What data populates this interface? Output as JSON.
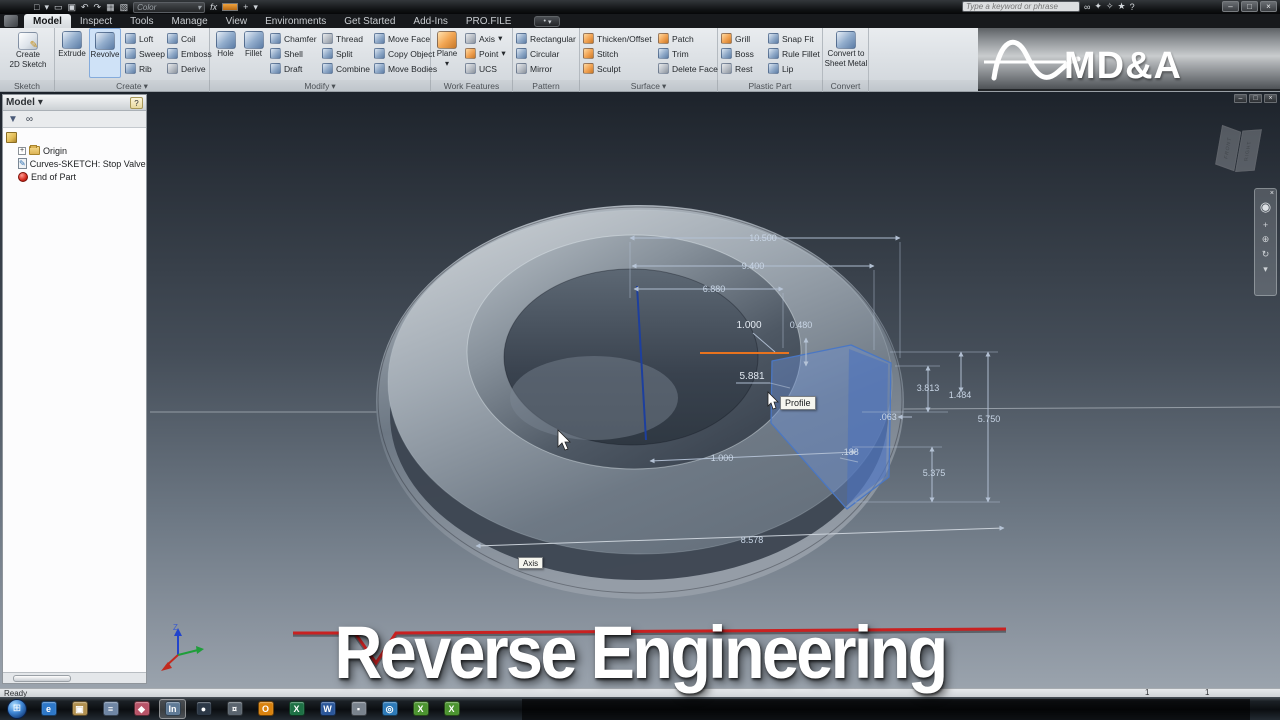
{
  "icons": {
    "caret": "▾",
    "plus": "+",
    "expander": "+",
    "dot": "•"
  },
  "app": {
    "search_placeholder": "Type a keyword or phrase",
    "tabs": [
      "Model",
      "Inspect",
      "Tools",
      "Manage",
      "View",
      "Environments",
      "Get Started",
      "Add-Ins",
      "PRO.FILE"
    ],
    "window": {
      "minimize": "–",
      "restore": "□",
      "close": "×"
    },
    "qat": {
      "color_label": "Color",
      "fx_label": "fx",
      "icons": [
        {
          "name": "new-file",
          "glyph": "□"
        },
        {
          "name": "open-file",
          "glyph": "▭"
        },
        {
          "name": "save-file",
          "glyph": "▣"
        },
        {
          "name": "undo",
          "glyph": "↶"
        },
        {
          "name": "redo",
          "glyph": "↷"
        },
        {
          "name": "image",
          "glyph": "▦"
        },
        {
          "name": "sketch-display",
          "glyph": "▧"
        }
      ]
    },
    "help_icons": [
      {
        "name": "search-binoculars",
        "glyph": "∞"
      },
      {
        "name": "subscription",
        "glyph": "✦"
      },
      {
        "name": "communication-center",
        "glyph": "✧"
      },
      {
        "name": "favorites",
        "glyph": "★"
      },
      {
        "name": "help",
        "glyph": "?"
      }
    ]
  },
  "ribbon": {
    "panel_sketch": {
      "label": "Sketch",
      "create2d_line1": "Create",
      "create2d_line2": "2D Sketch"
    },
    "panel_create": {
      "label": "Create",
      "extrude": "Extrude",
      "revolve": "Revolve",
      "loft": "Loft",
      "sweep": "Sweep",
      "rib": "Rib",
      "coil": "Coil",
      "emboss": "Emboss",
      "derive": "Derive"
    },
    "panel_modify": {
      "label": "Modify",
      "hole": "Hole",
      "fillet": "Fillet",
      "chamfer": "Chamfer",
      "shell": "Shell",
      "draft": "Draft",
      "thread": "Thread",
      "split": "Split",
      "combine": "Combine",
      "move_face": "Move Face",
      "copy_object": "Copy Object",
      "move_bodies": "Move Bodies"
    },
    "panel_work": {
      "label": "Work Features",
      "plane": "Plane",
      "axis": "Axis",
      "point": "Point",
      "ucs": "UCS"
    },
    "panel_pattern": {
      "label": "Pattern",
      "rectangular": "Rectangular",
      "circular": "Circular",
      "mirror": "Mirror"
    },
    "panel_surface": {
      "label": "Surface",
      "thicken": "Thicken/Offset",
      "stitch": "Stitch",
      "sculpt": "Sculpt",
      "patch": "Patch",
      "trim": "Trim",
      "delete_face": "Delete Face"
    },
    "panel_plastic": {
      "label": "Plastic Part",
      "grill": "Grill",
      "boss": "Boss",
      "rest": "Rest",
      "snap_fit": "Snap Fit",
      "rule_fillet": "Rule Fillet",
      "lip": "Lip"
    },
    "panel_convert": {
      "label": "Convert",
      "convert_line1": "Convert to",
      "convert_line2": "Sheet Metal"
    }
  },
  "browser": {
    "title": "Model",
    "filter_glyph": "▼",
    "find_glyph": "∞",
    "items": {
      "origin": "Origin",
      "sketch": "Curves-SKETCH:  Stop Valve Sea",
      "end_of_part": "End of Part"
    }
  },
  "viewport": {
    "dims": {
      "d1": "10.500",
      "d2": "9.400",
      "d3": "6.880",
      "d4": "1.000",
      "d5": "0.480",
      "d6": "5.881",
      "d7": "3.813",
      "d8": "1.484",
      "d9": "5.750",
      "d10": ".063",
      "d11": "5.375",
      "d12": ".188",
      "d13": "1.000",
      "d14": "8.578"
    },
    "profile_tooltip": "Profile",
    "axis_tooltip": "Axis",
    "viewcube": {
      "front": "FRONT",
      "right": "RIGHT"
    },
    "triad_z": "Z"
  },
  "overlay": {
    "title": "Reverse Engineering"
  },
  "brand": {
    "name": "MD&A"
  },
  "status": {
    "ready": "Ready",
    "count1": "1",
    "count2": "1"
  },
  "nav": {
    "close": "×",
    "wheel": "◉",
    "pan": "+",
    "zoom": "⊕",
    "orbit": "↻",
    "more": "▾"
  },
  "taskbar": {
    "items": [
      {
        "name": "internet-explorer",
        "glyph": "e",
        "color": "#2e78c8"
      },
      {
        "name": "file-explorer",
        "glyph": "▣",
        "color": "#b08f4e"
      },
      {
        "name": "notes-app",
        "glyph": "≡",
        "color": "#6f86a4"
      },
      {
        "name": "media-app",
        "glyph": "◆",
        "color": "#b85468"
      },
      {
        "name": "inventor-active",
        "glyph": "In",
        "color": "#5f7a96"
      },
      {
        "name": "dark-app",
        "glyph": "●",
        "color": "#2c3846"
      },
      {
        "name": "utility-app",
        "glyph": "¤",
        "color": "#5a646e"
      },
      {
        "name": "outlook",
        "glyph": "O",
        "color": "#d9820e"
      },
      {
        "name": "excel",
        "glyph": "X",
        "color": "#1e7145"
      },
      {
        "name": "word",
        "glyph": "W",
        "color": "#2b579a"
      },
      {
        "name": "phone-app",
        "glyph": "▪",
        "color": "#7a838d"
      },
      {
        "name": "browser-app",
        "glyph": "◎",
        "color": "#2d7ab8"
      },
      {
        "name": "green-app-1",
        "glyph": "X",
        "color": "#4c9430"
      },
      {
        "name": "green-app-2",
        "glyph": "X",
        "color": "#4c9430"
      }
    ]
  },
  "colors": {
    "accent_orange": "#e8731e",
    "dimension": "#c9d6e6",
    "profile_blue": "#5b82c4",
    "red_line": "#c92121"
  }
}
